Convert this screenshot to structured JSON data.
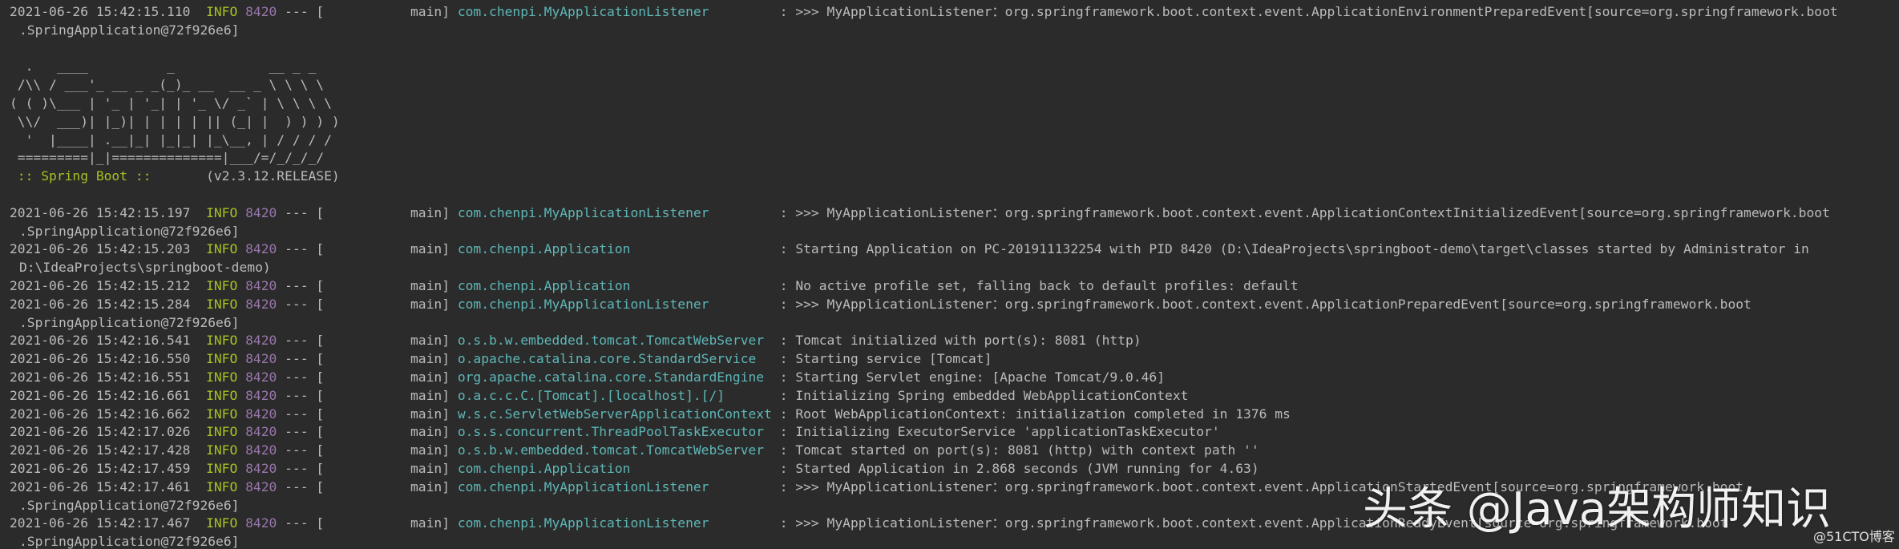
{
  "console": {
    "banner": [
      "  .   ____          _            __ _ _",
      " /\\\\ / ___'_ __ _ _(_)_ __  __ _ \\ \\ \\ \\",
      "( ( )\\___ | '_ | '_| | '_ \\/ _` | \\ \\ \\ \\",
      " \\\\/  ___)| |_)| | | | | || (_| |  ) ) ) )",
      "  '  |____| .__|_| |_|_| |_\\__, | / / / /",
      " =========|_|==============|___/=/_/_/_/"
    ],
    "spring_boot_label": " :: Spring Boot :: ",
    "spring_boot_version": "      (v2.3.12.RELEASE)",
    "first_entry": {
      "timestamp": "2021-06-26 15:42:15.110",
      "level": "INFO",
      "pid": "8420",
      "sep": "---",
      "thread": "[           main]",
      "logger": "com.chenpi.MyApplicationListener",
      "message": ": >>> MyApplicationListener：org.springframework.boot.context.event.ApplicationEnvironmentPreparedEvent[source=org.springframework.boot",
      "continuation": ".SpringApplication@72f926e6]"
    },
    "entries": [
      {
        "timestamp": "2021-06-26 15:42:15.197",
        "level": "INFO",
        "pid": "8420",
        "sep": "---",
        "thread": "[           main]",
        "logger": "com.chenpi.MyApplicationListener",
        "message": ": >>> MyApplicationListener：org.springframework.boot.context.event.ApplicationContextInitializedEvent[source=org.springframework.boot",
        "continuation": ".SpringApplication@72f926e6]"
      },
      {
        "timestamp": "2021-06-26 15:42:15.203",
        "level": "INFO",
        "pid": "8420",
        "sep": "---",
        "thread": "[           main]",
        "logger": "com.chenpi.Application",
        "message": ": Starting Application on PC-201911132254 with PID 8420 (D:\\IdeaProjects\\springboot-demo\\target\\classes started by Administrator in",
        "continuation": "D:\\IdeaProjects\\springboot-demo)"
      },
      {
        "timestamp": "2021-06-26 15:42:15.212",
        "level": "INFO",
        "pid": "8420",
        "sep": "---",
        "thread": "[           main]",
        "logger": "com.chenpi.Application",
        "message": ": No active profile set, falling back to default profiles: default"
      },
      {
        "timestamp": "2021-06-26 15:42:15.284",
        "level": "INFO",
        "pid": "8420",
        "sep": "---",
        "thread": "[           main]",
        "logger": "com.chenpi.MyApplicationListener",
        "message": ": >>> MyApplicationListener：org.springframework.boot.context.event.ApplicationPreparedEvent[source=org.springframework.boot",
        "continuation": ".SpringApplication@72f926e6]"
      },
      {
        "timestamp": "2021-06-26 15:42:16.541",
        "level": "INFO",
        "pid": "8420",
        "sep": "---",
        "thread": "[           main]",
        "logger": "o.s.b.w.embedded.tomcat.TomcatWebServer",
        "message": ": Tomcat initialized with port(s): 8081 (http)"
      },
      {
        "timestamp": "2021-06-26 15:42:16.550",
        "level": "INFO",
        "pid": "8420",
        "sep": "---",
        "thread": "[           main]",
        "logger": "o.apache.catalina.core.StandardService",
        "message": ": Starting service [Tomcat]"
      },
      {
        "timestamp": "2021-06-26 15:42:16.551",
        "level": "INFO",
        "pid": "8420",
        "sep": "---",
        "thread": "[           main]",
        "logger": "org.apache.catalina.core.StandardEngine",
        "message": ": Starting Servlet engine: [Apache Tomcat/9.0.46]"
      },
      {
        "timestamp": "2021-06-26 15:42:16.661",
        "level": "INFO",
        "pid": "8420",
        "sep": "---",
        "thread": "[           main]",
        "logger": "o.a.c.c.C.[Tomcat].[localhost].[/]",
        "message": ": Initializing Spring embedded WebApplicationContext"
      },
      {
        "timestamp": "2021-06-26 15:42:16.662",
        "level": "INFO",
        "pid": "8420",
        "sep": "---",
        "thread": "[           main]",
        "logger": "w.s.c.ServletWebServerApplicationContext",
        "message": ": Root WebApplicationContext: initialization completed in 1376 ms"
      },
      {
        "timestamp": "2021-06-26 15:42:17.026",
        "level": "INFO",
        "pid": "8420",
        "sep": "---",
        "thread": "[           main]",
        "logger": "o.s.s.concurrent.ThreadPoolTaskExecutor",
        "message": ": Initializing ExecutorService 'applicationTaskExecutor'"
      },
      {
        "timestamp": "2021-06-26 15:42:17.428",
        "level": "INFO",
        "pid": "8420",
        "sep": "---",
        "thread": "[           main]",
        "logger": "o.s.b.w.embedded.tomcat.TomcatWebServer",
        "message": ": Tomcat started on port(s): 8081 (http) with context path ''"
      },
      {
        "timestamp": "2021-06-26 15:42:17.459",
        "level": "INFO",
        "pid": "8420",
        "sep": "---",
        "thread": "[           main]",
        "logger": "com.chenpi.Application",
        "message": ": Started Application in 2.868 seconds (JVM running for 4.63)"
      },
      {
        "timestamp": "2021-06-26 15:42:17.461",
        "level": "INFO",
        "pid": "8420",
        "sep": "---",
        "thread": "[           main]",
        "logger": "com.chenpi.MyApplicationListener",
        "message": ": >>> MyApplicationListener：org.springframework.boot.context.event.ApplicationStartedEvent[source=org.springframework.boot",
        "continuation": ".SpringApplication@72f926e6]"
      },
      {
        "timestamp": "2021-06-26 15:42:17.467",
        "level": "INFO",
        "pid": "8420",
        "sep": "---",
        "thread": "[           main]",
        "logger": "com.chenpi.MyApplicationListener",
        "message": ": >>> MyApplicationListener：org.springframework.boot.context.event.ApplicationReadyEvent[source=org.springframework.boot",
        "continuation": ".SpringApplication@72f926e6]"
      }
    ]
  },
  "watermark": {
    "text": "头条 @Java架构师知识",
    "sub": "@51CTO博客"
  }
}
